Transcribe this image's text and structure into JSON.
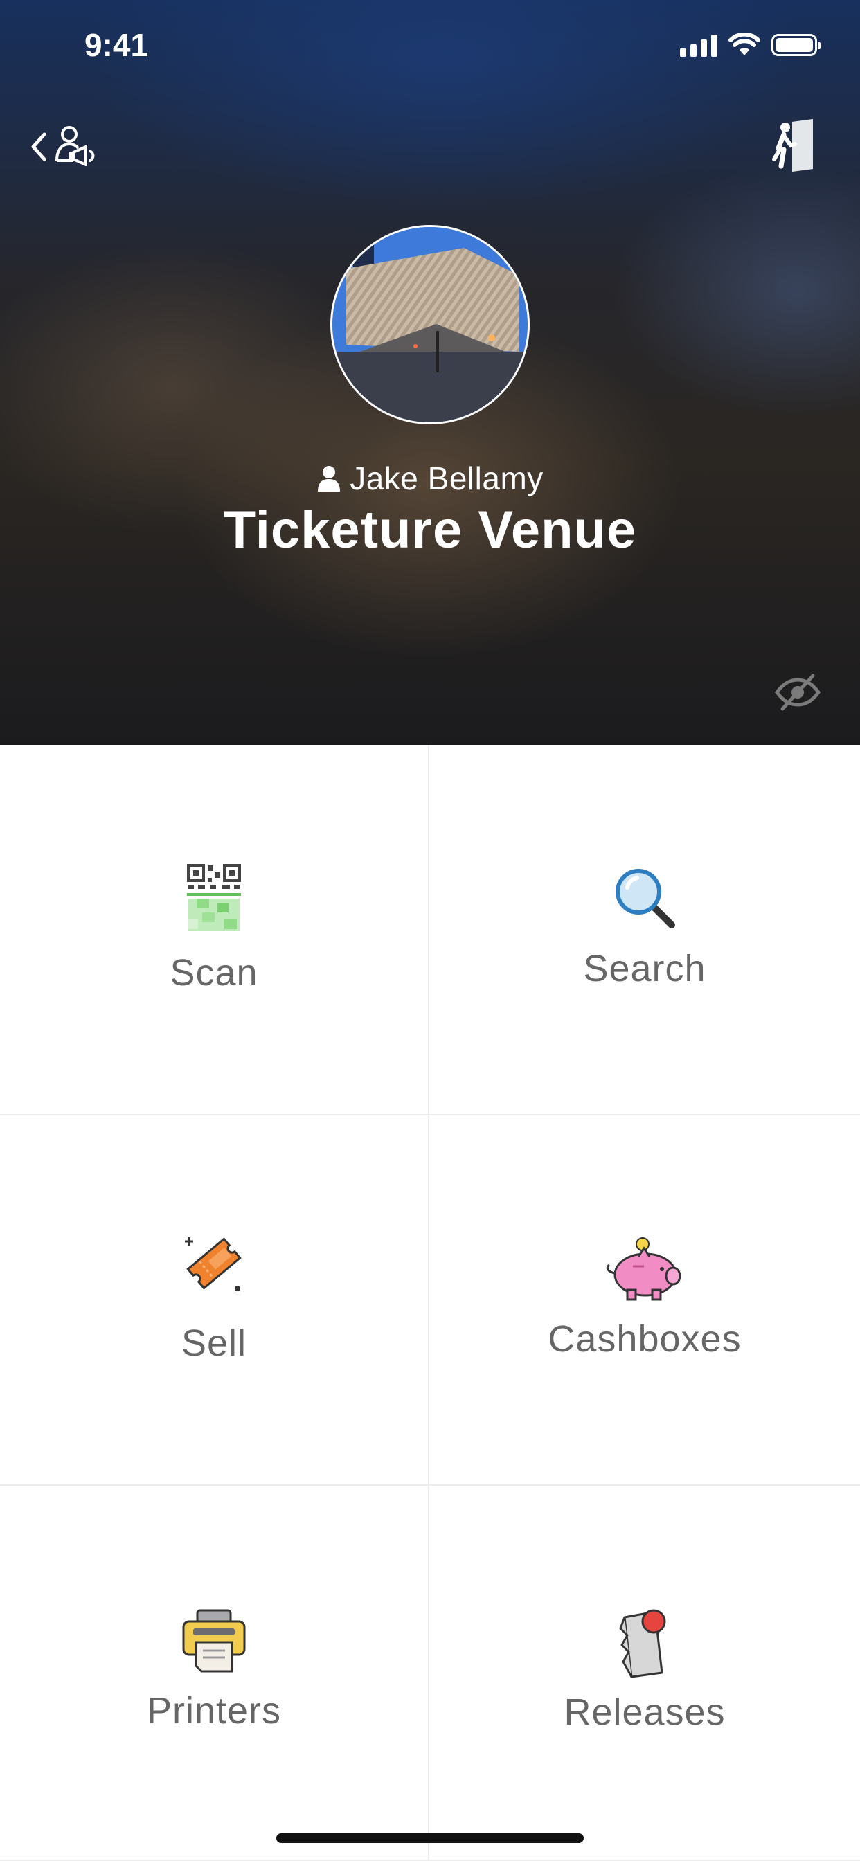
{
  "status_bar": {
    "time": "9:41"
  },
  "header": {
    "back_icon": "chevron-left-icon",
    "account_icon": "user-megaphone-icon",
    "exit_icon": "exit-door-icon",
    "visibility_icon": "eye-slash-icon"
  },
  "profile": {
    "avatar_icon": "venue-photo",
    "user_icon": "person-icon",
    "user_name": "Jake Bellamy",
    "venue_name": "Ticketure Venue"
  },
  "menu": {
    "scan": {
      "label": "Scan",
      "icon": "qr-code-icon"
    },
    "search": {
      "label": "Search",
      "icon": "magnifier-icon"
    },
    "sell": {
      "label": "Sell",
      "icon": "ticket-icon"
    },
    "cashboxes": {
      "label": "Cashboxes",
      "icon": "piggy-bank-icon"
    },
    "printers": {
      "label": "Printers",
      "icon": "printer-icon"
    },
    "releases": {
      "label": "Releases",
      "icon": "release-ticket-icon"
    }
  },
  "colors": {
    "label_gray": "#666666",
    "divider": "#ececec",
    "ticket_orange": "#f0822e",
    "piggy_pink": "#f28cc4",
    "printer_yellow": "#f2cc4f",
    "release_red": "#e6453f",
    "qr_green": "#7bd06f",
    "magnifier_blue": "#2e7fc1"
  }
}
